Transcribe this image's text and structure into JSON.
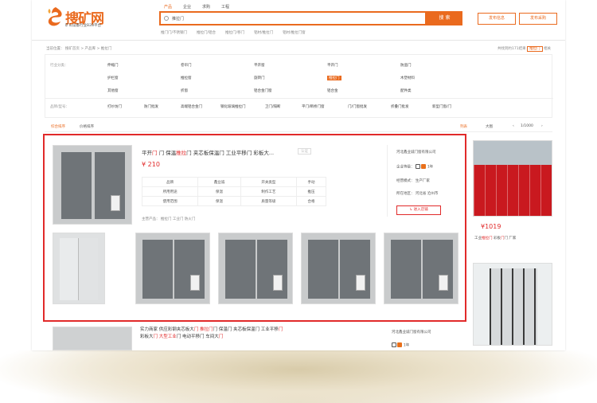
{
  "header": {
    "logo_text": "搜矿网",
    "logo_sub": "矿山设备行业B2B平台",
    "tabs": [
      "产品",
      "企业",
      "求购",
      "工程"
    ],
    "active_tab": 0,
    "search_value": "推拉门",
    "search_button": "搜 索",
    "hot_words": [
      "推门门/不锈钢门",
      "推拉门/铝合",
      "推拉门/移门",
      "铝材/推拉门",
      "铝材/推拉门窗"
    ],
    "publish_product": "发布信息",
    "publish_purchase": "发布采购"
  },
  "breadcrumb": {
    "path": "当前位置： 搜矿首页 > 产品库 > 推拉门",
    "right_prefix": "共找到约171结果",
    "right_query": "推拉门",
    "right_suffix": "相关"
  },
  "filter": {
    "row1_label": "行业分类：",
    "row2_label": "品牌/型号：",
    "items": [
      [
        "伸缩门",
        "卷帘门",
        "平开窗",
        "平开门",
        "防盗门"
      ],
      [
        "护栏窗",
        "推拉窗",
        "旋转门",
        "推拉门",
        "木塑材料"
      ],
      [
        "其他窗",
        "折窗",
        "铝合金门窗",
        "铝合金",
        "配件类"
      ]
    ],
    "active_item": "推拉门",
    "brands": [
      "打纱坊门",
      "防门批发",
      "高端铝合金门",
      "钢化玻璃推拉门",
      "卫门/隔断",
      "平门/断桥门窗",
      "门/门窗批发",
      "折叠门批发",
      "新型门窗/门"
    ]
  },
  "sort": {
    "left": [
      "综合排序",
      "价格排序"
    ],
    "active": 0,
    "right": [
      "列表",
      "大图"
    ],
    "pager": "1/1000"
  },
  "product": {
    "title_parts": [
      "平开",
      "门 保温",
      "推拉",
      "门 夹芯板保温",
      "门 工业平移",
      "门 彩板大..."
    ],
    "title_hl_index": [
      2
    ],
    "certified": "认证",
    "price": "¥ 210",
    "specs": [
      [
        "品牌",
        "鑫业诚",
        "开关类型",
        "手动"
      ],
      [
        "所用用途",
        "保温",
        "制作工艺",
        "推压"
      ],
      [
        "使用范围",
        "保温",
        "质量等级",
        "合格"
      ]
    ],
    "main_products": "主营产品：  推拉门 工业门 防火门",
    "seller_name": "河北鑫业诚门窗有限公司",
    "seller_grade_label": "企业等级：",
    "seller_years": "1年",
    "seller_type": "经营模式：  生产厂家",
    "seller_location": "所在地区：  河北省 沧州市",
    "contact_button": "进入店铺"
  },
  "side": {
    "price": "¥1019",
    "name_parts": [
      "工业",
      "推拉门",
      "彩板",
      "门 厂家"
    ]
  },
  "listing2": {
    "line1_parts": [
      "实力商家 供应彩钢夹芯板大",
      "门 推拉",
      "门 保温",
      "门 夹芯板保温",
      "门 工业平移",
      "门"
    ],
    "line2_parts": [
      "彩板大",
      "门 大型工业",
      "门 电动平移",
      "门 车间大",
      "门"
    ],
    "seller": "河北鑫业诚门窗有限公司",
    "grade": "1年"
  },
  "colors": {
    "accent": "#ea6a1e",
    "highlight": "#e12a2a",
    "frame": "#e12a2a"
  }
}
